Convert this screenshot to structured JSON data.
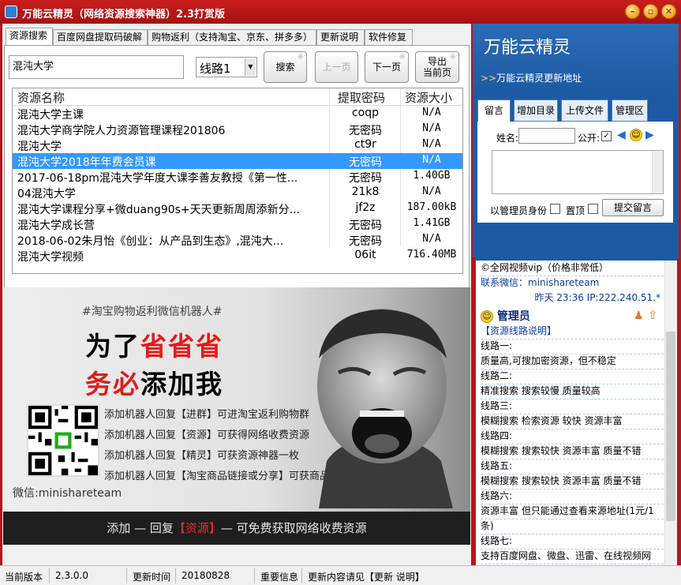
{
  "window": {
    "title": "万能云精灵（网络资源搜索神器）2.3打赏版",
    "min": "–",
    "max": "▫",
    "close": "✕"
  },
  "tabs": [
    "资源搜索",
    "百度网盘提取码破解",
    "购物返利（支持淘宝、京东、拼多多）",
    "更新说明",
    "软件修复"
  ],
  "search": {
    "value": "混沌大学",
    "route": "线路1",
    "search_btn": "搜索",
    "prev_btn": "上一页",
    "next_btn": "下一页",
    "export_btn_line1": "导出",
    "export_btn_line2": "当前页"
  },
  "table": {
    "headers": [
      "资源名称",
      "提取密码",
      "资源大小"
    ],
    "rows": [
      [
        "混沌大学主课",
        "coqp",
        "N/A"
      ],
      [
        "混沌大学商学院人力资源管理课程201806",
        "无密码",
        "N/A"
      ],
      [
        "混沌大学",
        "ct9r",
        "N/A"
      ],
      [
        "混沌大学2018年年费会员课",
        "无密码",
        "N/A"
      ],
      [
        "2017-06-18pm混沌大学年度大课李善友教授《第一性...",
        "无密码",
        "1.40GB"
      ],
      [
        "04混沌大学",
        "21k8",
        "N/A"
      ],
      [
        "混沌大学课程分享+微duang90s+天天更新周周添新分...",
        "jf2z",
        "187.00kB"
      ],
      [
        "混沌大学成长营",
        "无密码",
        "1.41GB"
      ],
      [
        "2018-06-02朱月怡《创业：从产品到生态》,混沌大...",
        "无密码",
        "N/A"
      ],
      [
        "混沌大学视频",
        "06it",
        "716.40MB"
      ]
    ]
  },
  "banner": {
    "hashtag": "#淘宝购物返利微信机器人#",
    "line1_a": "为了",
    "line1_b": "省省省",
    "line2_a": "务必",
    "line2_b": "添加我",
    "items": [
      "添加机器人回复【进群】可进淘宝返利购物群",
      "添加机器人回复【资源】可获得网络收费资源",
      "添加机器人回复【精灵】可获资源神器一枚",
      "添加机器人回复【淘宝商品链接或分享】可获商品返利详情"
    ],
    "wechat": "微信:minishareteam",
    "footer_a": "添加 — 回复",
    "footer_b": "【资源】",
    "footer_c": "— 可免费获取网络收费资源"
  },
  "right": {
    "title": "万能云精灵",
    "update_link": "万能云精灵更新地址",
    "update_chev": ">>",
    "tabs": [
      "留言",
      "增加目录",
      "上传文件",
      "管理区"
    ],
    "name_label": "姓名:",
    "public_label": "公开:",
    "admin_label": "以管理员身份",
    "top_label": "置顶",
    "submit": "提交留言"
  },
  "messages": {
    "m1": "©全网视频vip（价格非常低）",
    "m2": "联系微信：minishareteam",
    "m3": "昨天  23:36 IP:222.240.51.*",
    "admin": "管理员",
    "lines": [
      "【资源线路说明】",
      "线路一:",
      "质量高,可搜加密资源，但不稳定",
      "线路二:",
      "精准搜索  搜索较慢  质量较高",
      "线路三:",
      "模糊搜索  检索资源  较快  资源丰富",
      "线路四:",
      "模糊搜索  搜索较快  资源丰富  质量不错",
      "线路五:",
      "模糊搜索  搜索较快  资源丰富  质量不错",
      "线路六:",
      "资源丰富  但只能通过查看来源地址(1元/1",
      "条)",
      "线路七:",
      "支持百度网盘、微盘、迅雷、在线视频网"
    ]
  },
  "status": {
    "version_label": "当前版本",
    "version": "2.3.0.0",
    "time_label": "更新时间",
    "time": "20180828",
    "info_label": "重要信息",
    "info": "更新内容请见【更新 说明】"
  }
}
